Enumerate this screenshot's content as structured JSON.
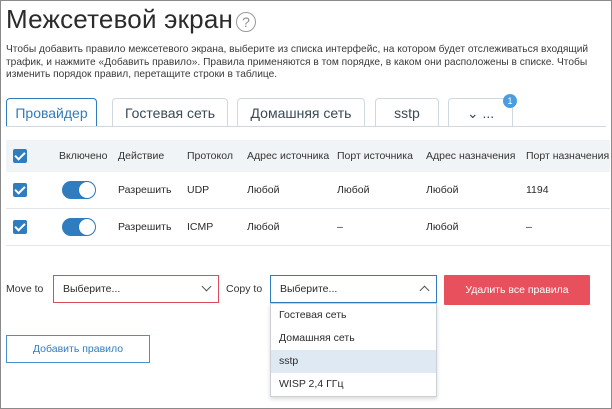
{
  "page": {
    "title": "Межсетевой экран",
    "help_glyph": "?",
    "description": "Чтобы добавить правило межсетевого экрана, выберите из списка интерфейс, на котором будет отслеживаться входящий трафик, и нажмите «Добавить правило». Правила применяются в том порядке, в каком они расположены в списке. Чтобы изменить порядок правил, перетащите строки в таблице."
  },
  "tabs": [
    {
      "label": "Провайдер",
      "active": true
    },
    {
      "label": "Гостевая сеть"
    },
    {
      "label": "Домашняя сеть"
    },
    {
      "label": "sstp"
    },
    {
      "label": "⌄ ...",
      "badge": "1"
    }
  ],
  "table": {
    "headers": [
      "Включено",
      "Действие",
      "Протокол",
      "Адрес источника",
      "Порт источника",
      "Адрес назначения",
      "Порт назначения"
    ],
    "rows": [
      {
        "checked": true,
        "enabled": true,
        "action": "Разрешить",
        "protocol": "UDP",
        "src_addr": "Любой",
        "src_port": "Любой",
        "dst_addr": "Любой",
        "dst_port": "1194"
      },
      {
        "checked": true,
        "enabled": true,
        "action": "Разрешить",
        "protocol": "ICMP",
        "src_addr": "Любой",
        "src_port": "–",
        "dst_addr": "Любой",
        "dst_port": "–"
      }
    ]
  },
  "controls": {
    "move_to_label": "Move to",
    "move_to_value": "Выберите...",
    "copy_to_label": "Copy to",
    "copy_to_value": "Выберите...",
    "delete_all_label": "Удалить все правила",
    "add_rule_label": "Добавить правило",
    "copy_options": [
      "Гостевая сеть",
      "Домашняя сеть",
      "sstp",
      "WISP 2,4 ГГц"
    ],
    "copy_highlighted": "sstp"
  },
  "colors": {
    "accent": "#2f7cbf",
    "danger": "#e8505e",
    "badge": "#4a9ee0"
  }
}
